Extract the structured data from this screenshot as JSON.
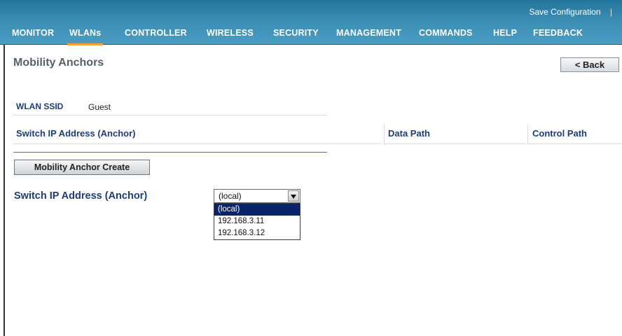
{
  "header": {
    "utility_link": "Save Configuration",
    "utility_separator": "|",
    "menu": [
      {
        "label": "MONITOR"
      },
      {
        "label": "WLANs"
      },
      {
        "label": "CONTROLLER"
      },
      {
        "label": "WIRELESS"
      },
      {
        "label": "SECURITY"
      },
      {
        "label": "MANAGEMENT"
      },
      {
        "label": "COMMANDS"
      },
      {
        "label": "HELP"
      },
      {
        "label": "FEEDBACK"
      }
    ],
    "active_tab": "WLANs",
    "accent_color": "#f2a33a",
    "bar_color": "#3a8db5"
  },
  "page": {
    "title": "Mobility Anchors",
    "back_label": "< Back"
  },
  "ssid": {
    "label": "WLAN SSID",
    "value": "Guest"
  },
  "table": {
    "headers": [
      "Switch IP Address (Anchor)",
      "Data Path",
      "Control Path"
    ],
    "rows": []
  },
  "create_button": "Mobility Anchor Create",
  "form": {
    "label": "Switch IP Address (Anchor)",
    "selected": "(local)",
    "options": [
      "(local)",
      "192.168.3.11",
      "192.168.3.12"
    ]
  }
}
